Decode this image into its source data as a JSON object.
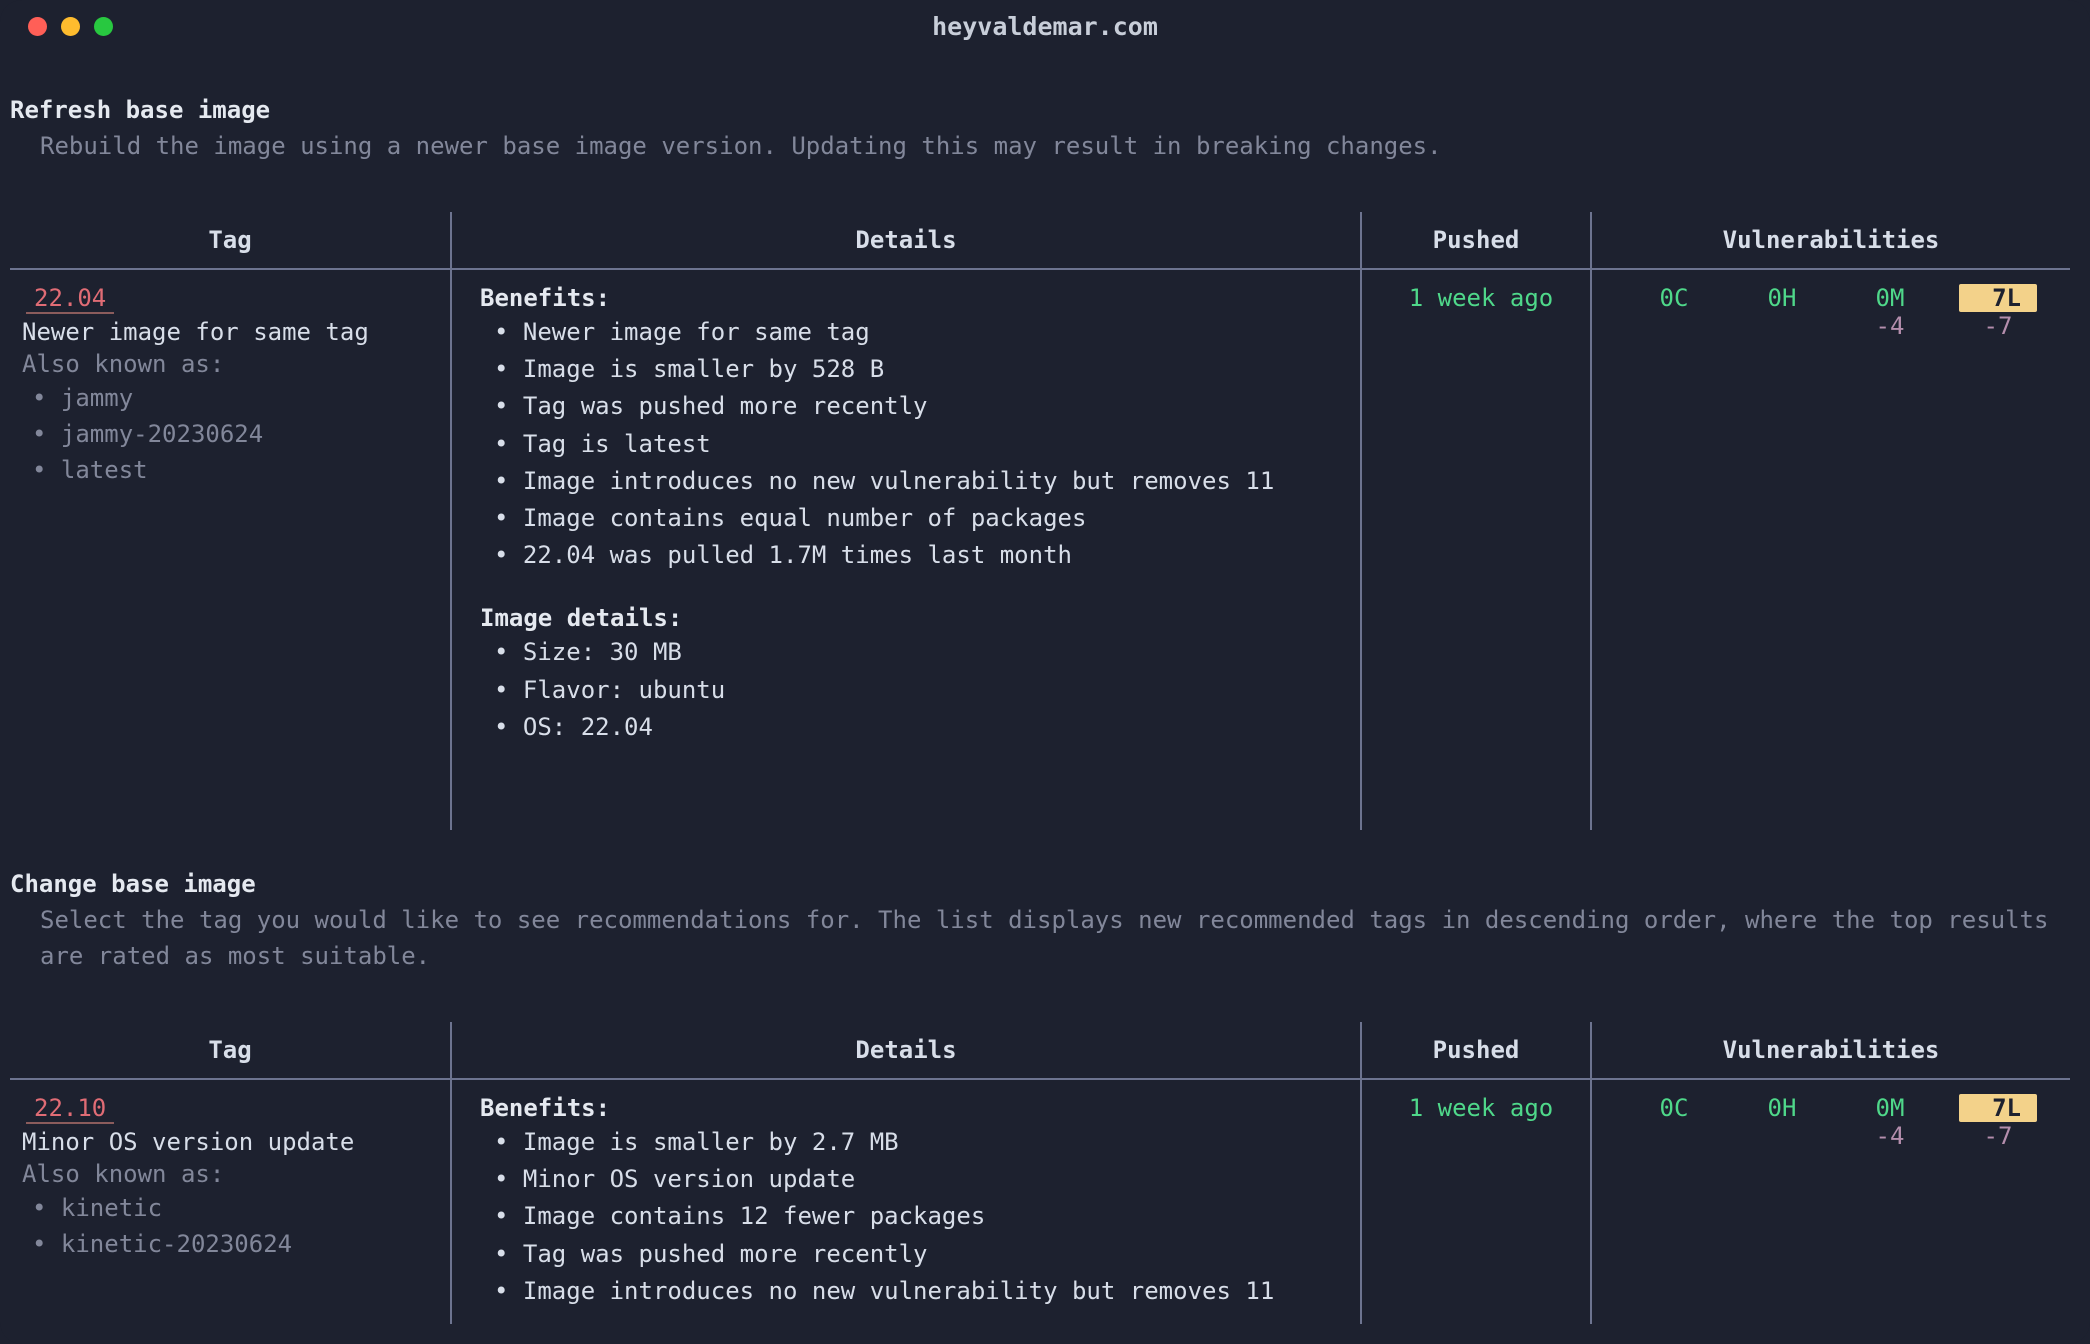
{
  "window": {
    "title": "heyvaldemar.com"
  },
  "sections": [
    {
      "title": "Refresh base image",
      "description": "Rebuild the image using a newer base image version. Updating this may result in breaking changes.",
      "headers": {
        "tag": "Tag",
        "details": "Details",
        "pushed": "Pushed",
        "vulnerabilities": "Vulnerabilities"
      },
      "row": {
        "tag": "22.04",
        "subtitle": "Newer image for same tag",
        "aka_label": "Also known as:",
        "aka": [
          "jammy",
          "jammy-20230624",
          "latest"
        ],
        "benefits_label": "Benefits:",
        "benefits": [
          "Newer image for same tag",
          "Image is smaller by 528 B",
          "Tag was pushed more recently",
          "Tag is latest",
          "Image introduces no new vulnerability but removes 11",
          "Image contains equal number of packages",
          "22.04 was pulled 1.7M times last month"
        ],
        "image_details_label": "Image details:",
        "image_details": [
          "Size: 30 MB",
          "Flavor: ubuntu",
          "OS: 22.04"
        ],
        "pushed": "1 week ago",
        "vulns": {
          "critical": "0C",
          "high": "0H",
          "medium": "0M",
          "low": "7L",
          "medium_delta": "-4",
          "low_delta": "-7"
        }
      }
    },
    {
      "title": "Change base image",
      "description": "Select the tag you would like to see recommendations for. The list displays new recommended tags in descending order, where the top results are rated as most suitable.",
      "headers": {
        "tag": "Tag",
        "details": "Details",
        "pushed": "Pushed",
        "vulnerabilities": "Vulnerabilities"
      },
      "row": {
        "tag": "22.10",
        "subtitle": "Minor OS version update",
        "aka_label": "Also known as:",
        "aka": [
          "kinetic",
          "kinetic-20230624"
        ],
        "benefits_label": "Benefits:",
        "benefits": [
          "Image is smaller by 2.7 MB",
          "Minor OS version update",
          "Image contains 12 fewer packages",
          "Tag was pushed more recently",
          "Image introduces no new vulnerability but removes 11"
        ],
        "pushed": "1 week ago",
        "vulns": {
          "critical": "0C",
          "high": "0H",
          "medium": "0M",
          "low": "7L",
          "medium_delta": "-4",
          "low_delta": "-7"
        }
      }
    }
  ]
}
